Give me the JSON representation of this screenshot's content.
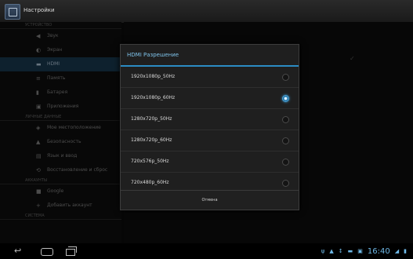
{
  "app": {
    "title": "Настройки"
  },
  "sidebar": {
    "section_devices": "Устройство",
    "items": [
      {
        "label": "Звук",
        "icon": "speaker-icon",
        "glyph": "◀"
      },
      {
        "label": "Экран",
        "icon": "display-icon",
        "glyph": "◐"
      },
      {
        "label": "HDMI",
        "icon": "hdmi-icon",
        "glyph": "▬"
      },
      {
        "label": "Память",
        "icon": "storage-icon",
        "glyph": "≡"
      },
      {
        "label": "Батарея",
        "icon": "battery-icon",
        "glyph": "▮"
      },
      {
        "label": "Приложения",
        "icon": "apps-icon",
        "glyph": "▣"
      }
    ],
    "section_personal": "Личные данные",
    "items2": [
      {
        "label": "Мое местоположение",
        "icon": "location-icon",
        "glyph": "◈"
      },
      {
        "label": "Безопасность",
        "icon": "lock-icon",
        "glyph": "▲"
      },
      {
        "label": "Язык и ввод",
        "icon": "language-icon",
        "glyph": "▤"
      },
      {
        "label": "Восстановление и сброс",
        "icon": "restore-icon",
        "glyph": "⟲"
      }
    ],
    "section_accounts": "Аккаунты",
    "items3": [
      {
        "label": "Google",
        "icon": "google-icon",
        "glyph": "■"
      },
      {
        "label": "Добавить аккаунт",
        "icon": "add-icon",
        "glyph": "+"
      }
    ],
    "section_system": "Система"
  },
  "dialog": {
    "title": "HDMI Разрешение",
    "options": [
      {
        "label": "1920x1080p_50Hz",
        "selected": false
      },
      {
        "label": "1920x1080p_60Hz",
        "selected": true
      },
      {
        "label": "1280x720p_50Hz",
        "selected": false
      },
      {
        "label": "1280x720p_60Hz",
        "selected": false
      },
      {
        "label": "720x576p_50Hz",
        "selected": false
      },
      {
        "label": "720x480p_60Hz",
        "selected": false
      }
    ],
    "cancel": "Отмена"
  },
  "statusbar": {
    "time": "16:40"
  },
  "colors": {
    "accent": "#2b8bc4",
    "title_text": "#7fc3ea",
    "clock": "#6fb8e6"
  }
}
